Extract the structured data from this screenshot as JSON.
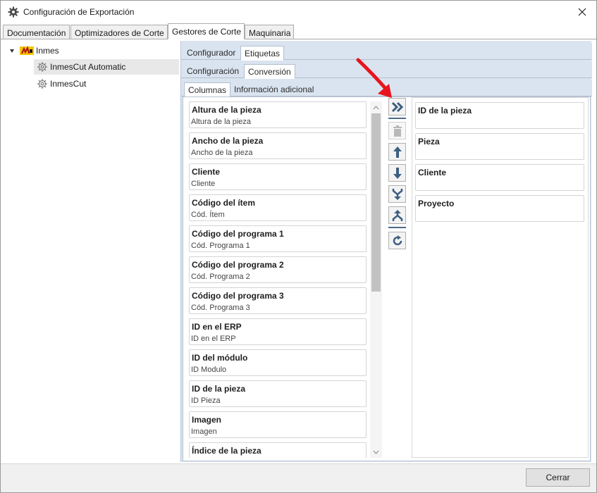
{
  "window": {
    "title": "Configuración de Exportación"
  },
  "top_tabs": [
    {
      "label": "Documentación"
    },
    {
      "label": "Optimizadores de Corte"
    },
    {
      "label": "Gestores de Corte",
      "active": true
    },
    {
      "label": "Maquinaria"
    }
  ],
  "tree": {
    "root": {
      "label": "Inmes",
      "icon": "inmes-logo-icon"
    },
    "children": [
      {
        "label": "InmesCut Automatic",
        "icon": "gear-icon",
        "selected": true
      },
      {
        "label": "InmesCut",
        "icon": "gear-icon"
      }
    ]
  },
  "level1_tabs": [
    {
      "label": "Configurador"
    },
    {
      "label": "Etiquetas",
      "active": true
    }
  ],
  "level2_tabs": [
    {
      "label": "Configuración"
    },
    {
      "label": "Conversión",
      "active": true
    }
  ],
  "level3_tabs": [
    {
      "label": "Columnas",
      "active": true
    },
    {
      "label": "Información adicional"
    }
  ],
  "available_columns": [
    {
      "name": "Altura de la pieza",
      "sub": "Altura de la pieza"
    },
    {
      "name": "Ancho de la pieza",
      "sub": "Ancho de la pieza"
    },
    {
      "name": "Cliente",
      "sub": "Cliente"
    },
    {
      "name": "Código del ítem",
      "sub": "Cód. Ítem"
    },
    {
      "name": "Código del programa 1",
      "sub": "Cód. Programa 1"
    },
    {
      "name": "Código del programa 2",
      "sub": "Cód. Programa 2"
    },
    {
      "name": "Código del programa 3",
      "sub": "Cód. Programa 3"
    },
    {
      "name": "ID en el ERP",
      "sub": "ID en el ERP"
    },
    {
      "name": "ID del módulo",
      "sub": "ID Modulo"
    },
    {
      "name": "ID de la pieza",
      "sub": "ID Pieza"
    },
    {
      "name": "Imagen",
      "sub": "Imagen"
    },
    {
      "name": "Índice de la pieza",
      "sub": ""
    }
  ],
  "selected_columns": [
    {
      "name": "ID de la pieza"
    },
    {
      "name": "Pieza"
    },
    {
      "name": "Cliente"
    },
    {
      "name": "Proyecto"
    }
  ],
  "toolbar": {
    "buttons": [
      {
        "icon": "double-chevron-right-icon"
      },
      {
        "icon": "trash-icon",
        "disabled": true
      },
      {
        "icon": "arrow-up-icon"
      },
      {
        "icon": "arrow-down-icon"
      },
      {
        "icon": "merge-down-icon"
      },
      {
        "icon": "split-up-icon"
      },
      {
        "icon": "refresh-icon"
      }
    ]
  },
  "footer": {
    "close_label": "Cerrar"
  },
  "colors": {
    "panel_bg": "#dae4f0",
    "icon_blue": "#3d5f82",
    "annotation_red": "#e8141e"
  }
}
